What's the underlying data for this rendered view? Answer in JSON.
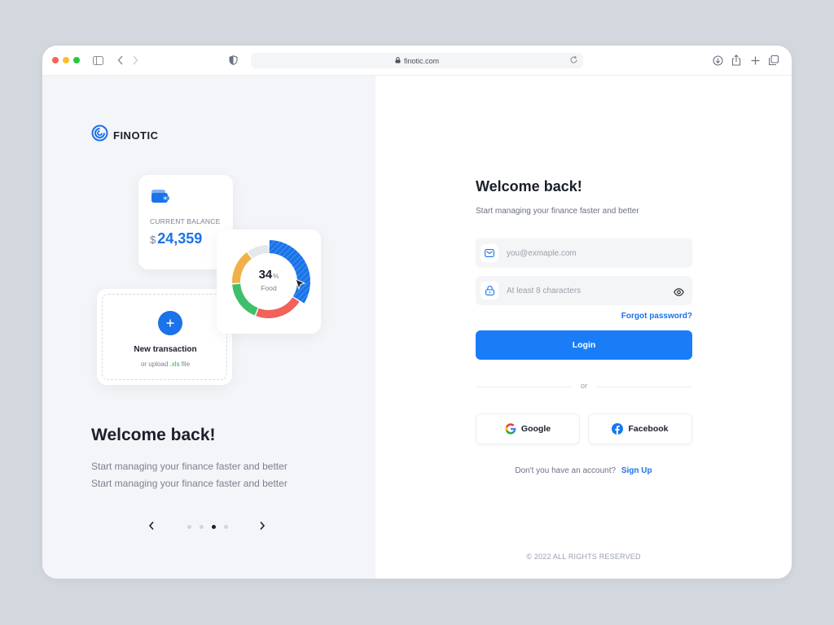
{
  "browser": {
    "url": "finotic.com"
  },
  "brand": {
    "name": "FINOTIC",
    "accent": "#1a73e8"
  },
  "showcase": {
    "balance": {
      "label": "CURRENT BALANCE",
      "currency": "$",
      "amount": "24,359"
    },
    "upload": {
      "title": "New transaction",
      "sub_prefix": "or upload ",
      "sub_ext": ".xls",
      "sub_suffix": " file"
    },
    "donut": {
      "percent": "34",
      "unit": "%",
      "label": "Food",
      "segments": [
        {
          "name": "blue",
          "fraction": 0.34,
          "color": "#1a73e8"
        },
        {
          "name": "red",
          "fraction": 0.22,
          "color": "#f0625a"
        },
        {
          "name": "green",
          "fraction": 0.18,
          "color": "#3fbf6a"
        },
        {
          "name": "yellow",
          "fraction": 0.16,
          "color": "#f0b14a"
        },
        {
          "name": "gray",
          "fraction": 0.1,
          "color": "#e4e7ec"
        }
      ]
    },
    "title": "Welcome back!",
    "subtitle_line1": "Start managing your finance faster and better",
    "subtitle_line2": "Start managing your finance faster and better",
    "pager": {
      "count": 4,
      "active": 3
    }
  },
  "login": {
    "title": "Welcome back!",
    "subtitle": "Start managing your finance faster and better",
    "email_placeholder": "you@exmaple.com",
    "password_placeholder": "At least 8 characters",
    "forgot_label": "Forgot password?",
    "login_label": "Login",
    "or_label": "or",
    "google_label": "Google",
    "facebook_label": "Facebook",
    "no_account_text": "Don't you have an account?",
    "signup_label": "Sign Up",
    "copyright": "© 2022 ALL RIGHTS RESERVED"
  }
}
